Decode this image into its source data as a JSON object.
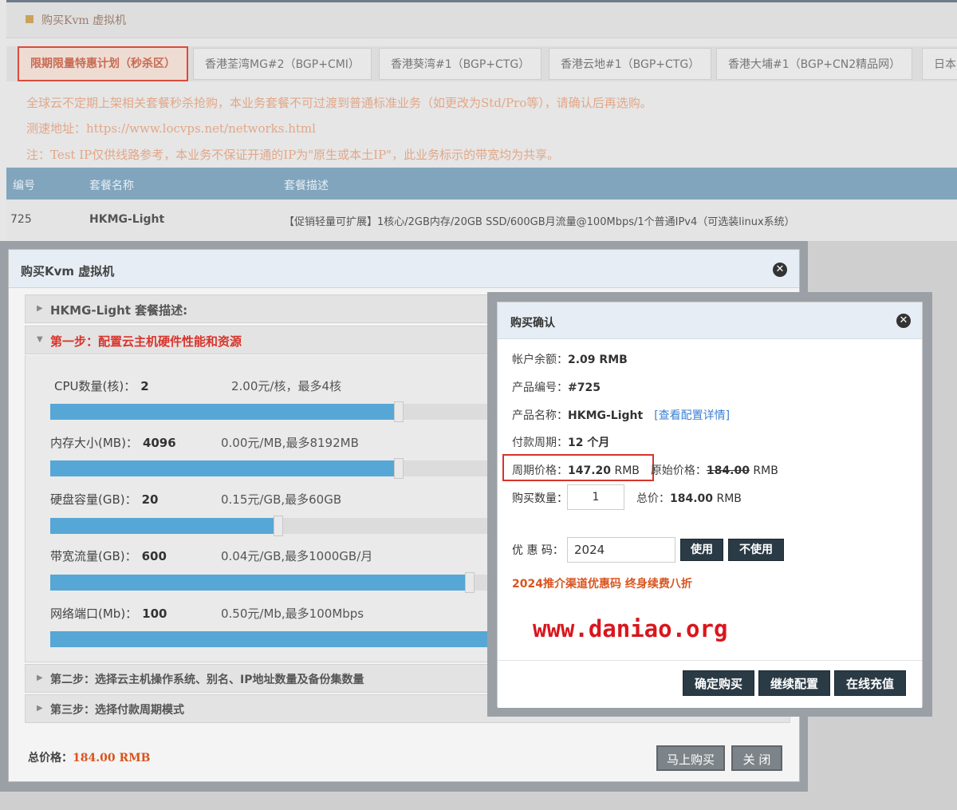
{
  "page": {
    "title": "购买Kvm 虚拟机",
    "tabs": [
      "限期限量特惠计划（秒杀区）",
      "香港荃湾MG#2（BGP+CMI）",
      "香港葵湾#1（BGP+CTG）",
      "香港云地#1（BGP+CTG）",
      "香港大埔#1（BGP+CN2精品网）",
      "日本"
    ],
    "notices": [
      "全球云不定期上架相关套餐秒杀抢购，本业务套餐不可过渡到普通标准业务（如更改为Std/Pro等），请确认后再选购。",
      "测速地址：https://www.locvps.net/networks.html",
      "注：Test IP仅供线路参考，本业务不保证开通的IP为\"原生或本土IP\"，此业务标示的带宽均为共享。"
    ],
    "table": {
      "headers": [
        "编号",
        "套餐名称",
        "套餐描述"
      ],
      "row": [
        "725",
        "HKMG-Light",
        "【促销轻量可扩展】1核心/2GB内存/20GB SSD/600GB月流量@100Mbps/1个普通IPv4（可选装linux系统）"
      ]
    }
  },
  "main_dialog": {
    "title": "购买Kvm 虚拟机",
    "desc_section": "HKMG-Light 套餐描述:",
    "step1": "第一步：配置云主机硬件性能和资源",
    "step2": "第二步：选择云主机操作系统、别名、IP地址数量及备份集数量",
    "step3": "第三步：选择付款周期模式",
    "resources": [
      {
        "label": "CPU数量(核)：",
        "value": "2",
        "price": "2.00元/核，最多4核",
        "fill": 0.78
      },
      {
        "label": "内存大小(MB)：",
        "value": "4096",
        "price": "0.00元/MB,最多8192MB",
        "fill": 0.78
      },
      {
        "label": "硬盘容量(GB)：",
        "value": "20",
        "price": "0.15元/GB,最多60GB",
        "fill": 0.51
      },
      {
        "label": "带宽流量(GB)：",
        "value": "600",
        "price": "0.04元/GB,最多1000GB/月",
        "fill": 0.94
      },
      {
        "label": "网络端口(Mb)：",
        "value": "100",
        "price": "0.50元/Mb,最多100Mbps",
        "fill": 1.0
      }
    ],
    "total_label": "总价格：",
    "total_value": "184.00 RMB",
    "buy_button": "马上购买",
    "close_button": "关 闭"
  },
  "confirm": {
    "title": "购买确认",
    "balance_label": "帐户余额：",
    "balance": "2.09 RMB",
    "product_no_label": "产品编号：",
    "product_no": "#725",
    "product_name_label": "产品名称：",
    "product_name": "HKMG-Light",
    "details_link": "[查看配置详情]",
    "period_label": "付款周期：",
    "period": "12 个月",
    "period_price_label": "周期价格：",
    "period_price": "147.20",
    "currency": "RMB",
    "orig_price_label": "原始价格：",
    "orig_price": "184.00",
    "qty_label": "购买数量：",
    "qty": "1",
    "total_label": "总价：",
    "total": "184.00",
    "coupon_label": "优 惠 码：",
    "coupon": "2024",
    "use_btn": "使用",
    "nouse_btn": "不使用",
    "promo": "2024推介渠道优惠码 终身续费八折",
    "watermark": "www.daniao.org",
    "confirm_btn": "确定购买",
    "continue_btn": "继续配置",
    "recharge_btn": "在线充值"
  }
}
